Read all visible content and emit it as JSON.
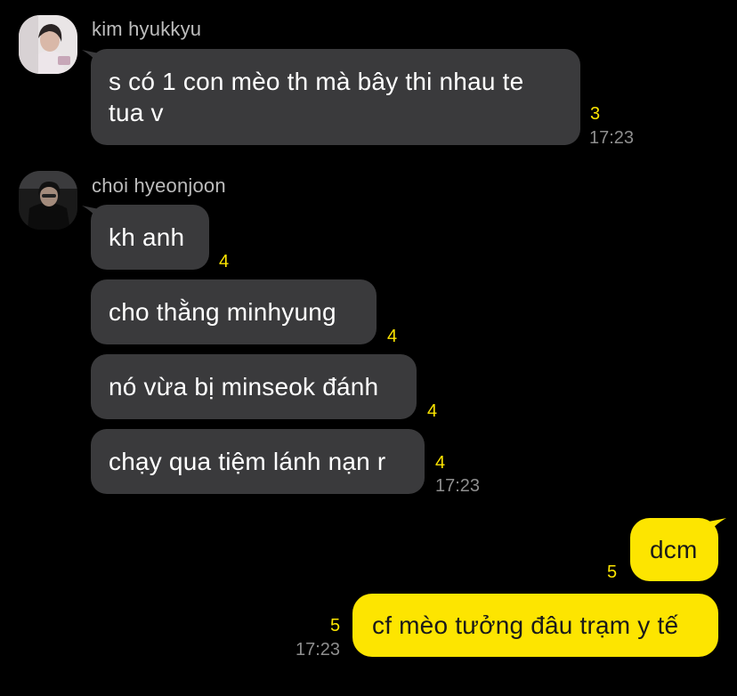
{
  "theme": {
    "background": "#000000",
    "incoming_bubble": "#3a3a3c",
    "outgoing_bubble": "#fde500",
    "unread_color": "#fde500",
    "time_color": "#8e8e8e"
  },
  "groups": [
    {
      "sender": "kim hyukkyu",
      "avatar_icon": "profile-photo-icon",
      "messages": [
        {
          "lines": [
            "s có 1 con mèo th mà bây thi nhau te",
            "tua v"
          ],
          "unread": "3",
          "time": "17:23"
        }
      ]
    },
    {
      "sender": "choi hyeonjoon",
      "avatar_icon": "profile-photo-icon",
      "messages": [
        {
          "lines": [
            "kh anh"
          ],
          "unread": "4"
        },
        {
          "lines": [
            "cho thằng minhyung"
          ],
          "unread": "4"
        },
        {
          "lines": [
            "nó vừa bị minseok đánh"
          ],
          "unread": "4"
        },
        {
          "lines": [
            "chạy qua tiệm lánh nạn r"
          ],
          "unread": "4",
          "time": "17:23"
        }
      ]
    }
  ],
  "outgoing": [
    {
      "lines": [
        "dcm"
      ],
      "unread": "5"
    },
    {
      "lines": [
        "cf mèo tưởng đâu trạm y tế"
      ],
      "unread": "5",
      "time": "17:23"
    }
  ]
}
